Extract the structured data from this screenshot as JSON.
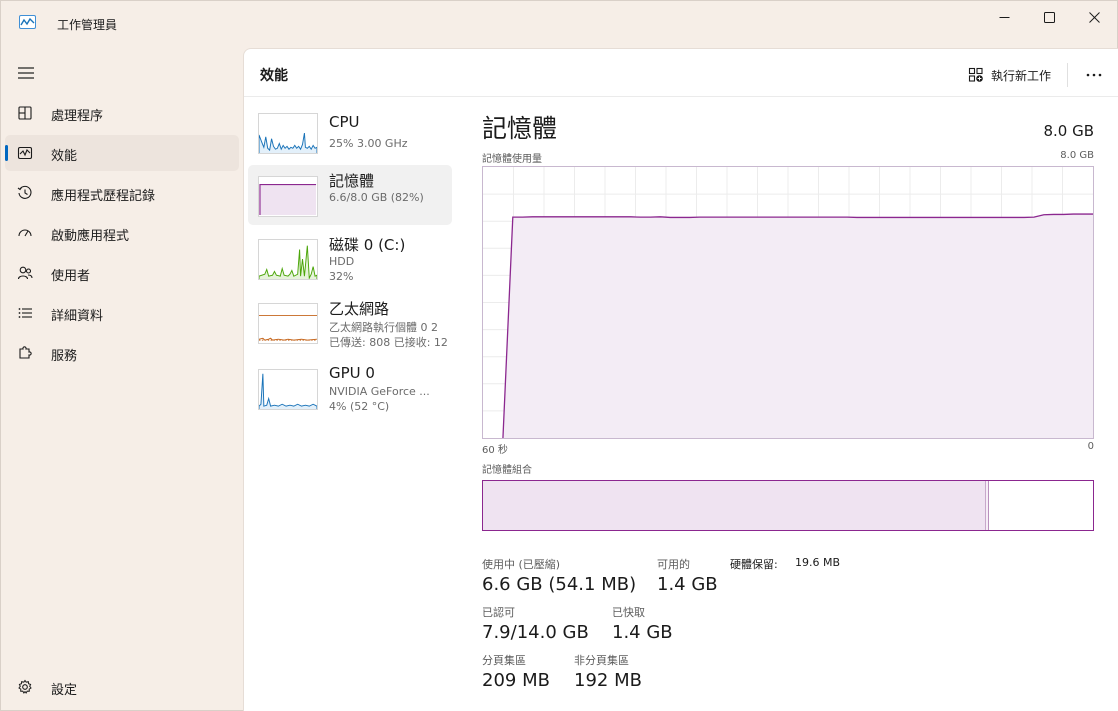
{
  "window": {
    "title": "工作管理員"
  },
  "nav": {
    "items": [
      {
        "label": "處理程序",
        "icon": "processes-grid-icon",
        "active": false
      },
      {
        "label": "效能",
        "icon": "performance-chart-icon",
        "active": true
      },
      {
        "label": "應用程式歷程記錄",
        "icon": "history-clock-icon",
        "active": false
      },
      {
        "label": "啟動應用程式",
        "icon": "startup-speedometer-icon",
        "active": false
      },
      {
        "label": "使用者",
        "icon": "users-icon",
        "active": false
      },
      {
        "label": "詳細資料",
        "icon": "details-list-icon",
        "active": false
      },
      {
        "label": "服務",
        "icon": "services-puzzle-icon",
        "active": false
      }
    ],
    "settings_label": "設定"
  },
  "header": {
    "title": "效能",
    "new_task_label": "執行新工作"
  },
  "resources": [
    {
      "title": "CPU",
      "lines": [
        "25%  3.00 GHz"
      ],
      "color": "#1a73b8",
      "selected": false
    },
    {
      "title": "記憶體",
      "lines": [
        "6.6/8.0 GB (82%)"
      ],
      "color": "#8b278f",
      "selected": true
    },
    {
      "title": "磁碟 0 (C:)",
      "lines": [
        "HDD",
        "32%"
      ],
      "color": "#4ca60a",
      "selected": false
    },
    {
      "title": "乙太網路",
      "lines": [
        "乙太網路執行個體 0 2",
        "已傳送: 808 已接收: 12"
      ],
      "color": "#c5651b",
      "selected": false
    },
    {
      "title": "GPU 0",
      "lines": [
        "NVIDIA GeForce ...",
        "4%  (52 °C)"
      ],
      "color": "#1a73b8",
      "selected": false
    }
  ],
  "detail": {
    "title": "記憶體",
    "total": "8.0 GB",
    "usage_label": "記憶體使用量",
    "usage_max": "8.0 GB",
    "time_left": "60 秒",
    "time_right": "0",
    "composition_label": "記憶體組合",
    "composition": {
      "in_use_fraction": 0.825,
      "modified_fraction": 0.004
    },
    "line_color": "#8b278f",
    "usage_series_gb": [
      0,
      6.52,
      6.52,
      6.53,
      6.53,
      6.53,
      6.53,
      6.53,
      6.53,
      6.53,
      6.53,
      6.53,
      6.53,
      6.53,
      6.52,
      6.52,
      6.53,
      6.51,
      6.51,
      6.51,
      6.52,
      6.52,
      6.52,
      6.52,
      6.52,
      6.52,
      6.52,
      6.52,
      6.52,
      6.52,
      6.52,
      6.52,
      6.52,
      6.52,
      6.52,
      6.52,
      6.51,
      6.51,
      6.51,
      6.51,
      6.51,
      6.51,
      6.51,
      6.51,
      6.51,
      6.51,
      6.51,
      6.51,
      6.51,
      6.51,
      6.51,
      6.51,
      6.51,
      6.51,
      6.52,
      6.59,
      6.6,
      6.6,
      6.61,
      6.61,
      6.61
    ]
  },
  "stats": {
    "in_use_label": "使用中 (已壓縮)",
    "in_use_value": "6.6 GB (54.1 MB)",
    "available_label": "可用的",
    "available_value": "1.4 GB",
    "hw_reserved_label": "硬體保留:",
    "hw_reserved_value": "19.6 MB",
    "committed_label": "已認可",
    "committed_value": "7.9/14.0 GB",
    "cached_label": "已快取",
    "cached_value": "1.4 GB",
    "paged_label": "分頁集區",
    "paged_value": "209 MB",
    "nonpaged_label": "非分頁集區",
    "nonpaged_value": "192 MB"
  }
}
